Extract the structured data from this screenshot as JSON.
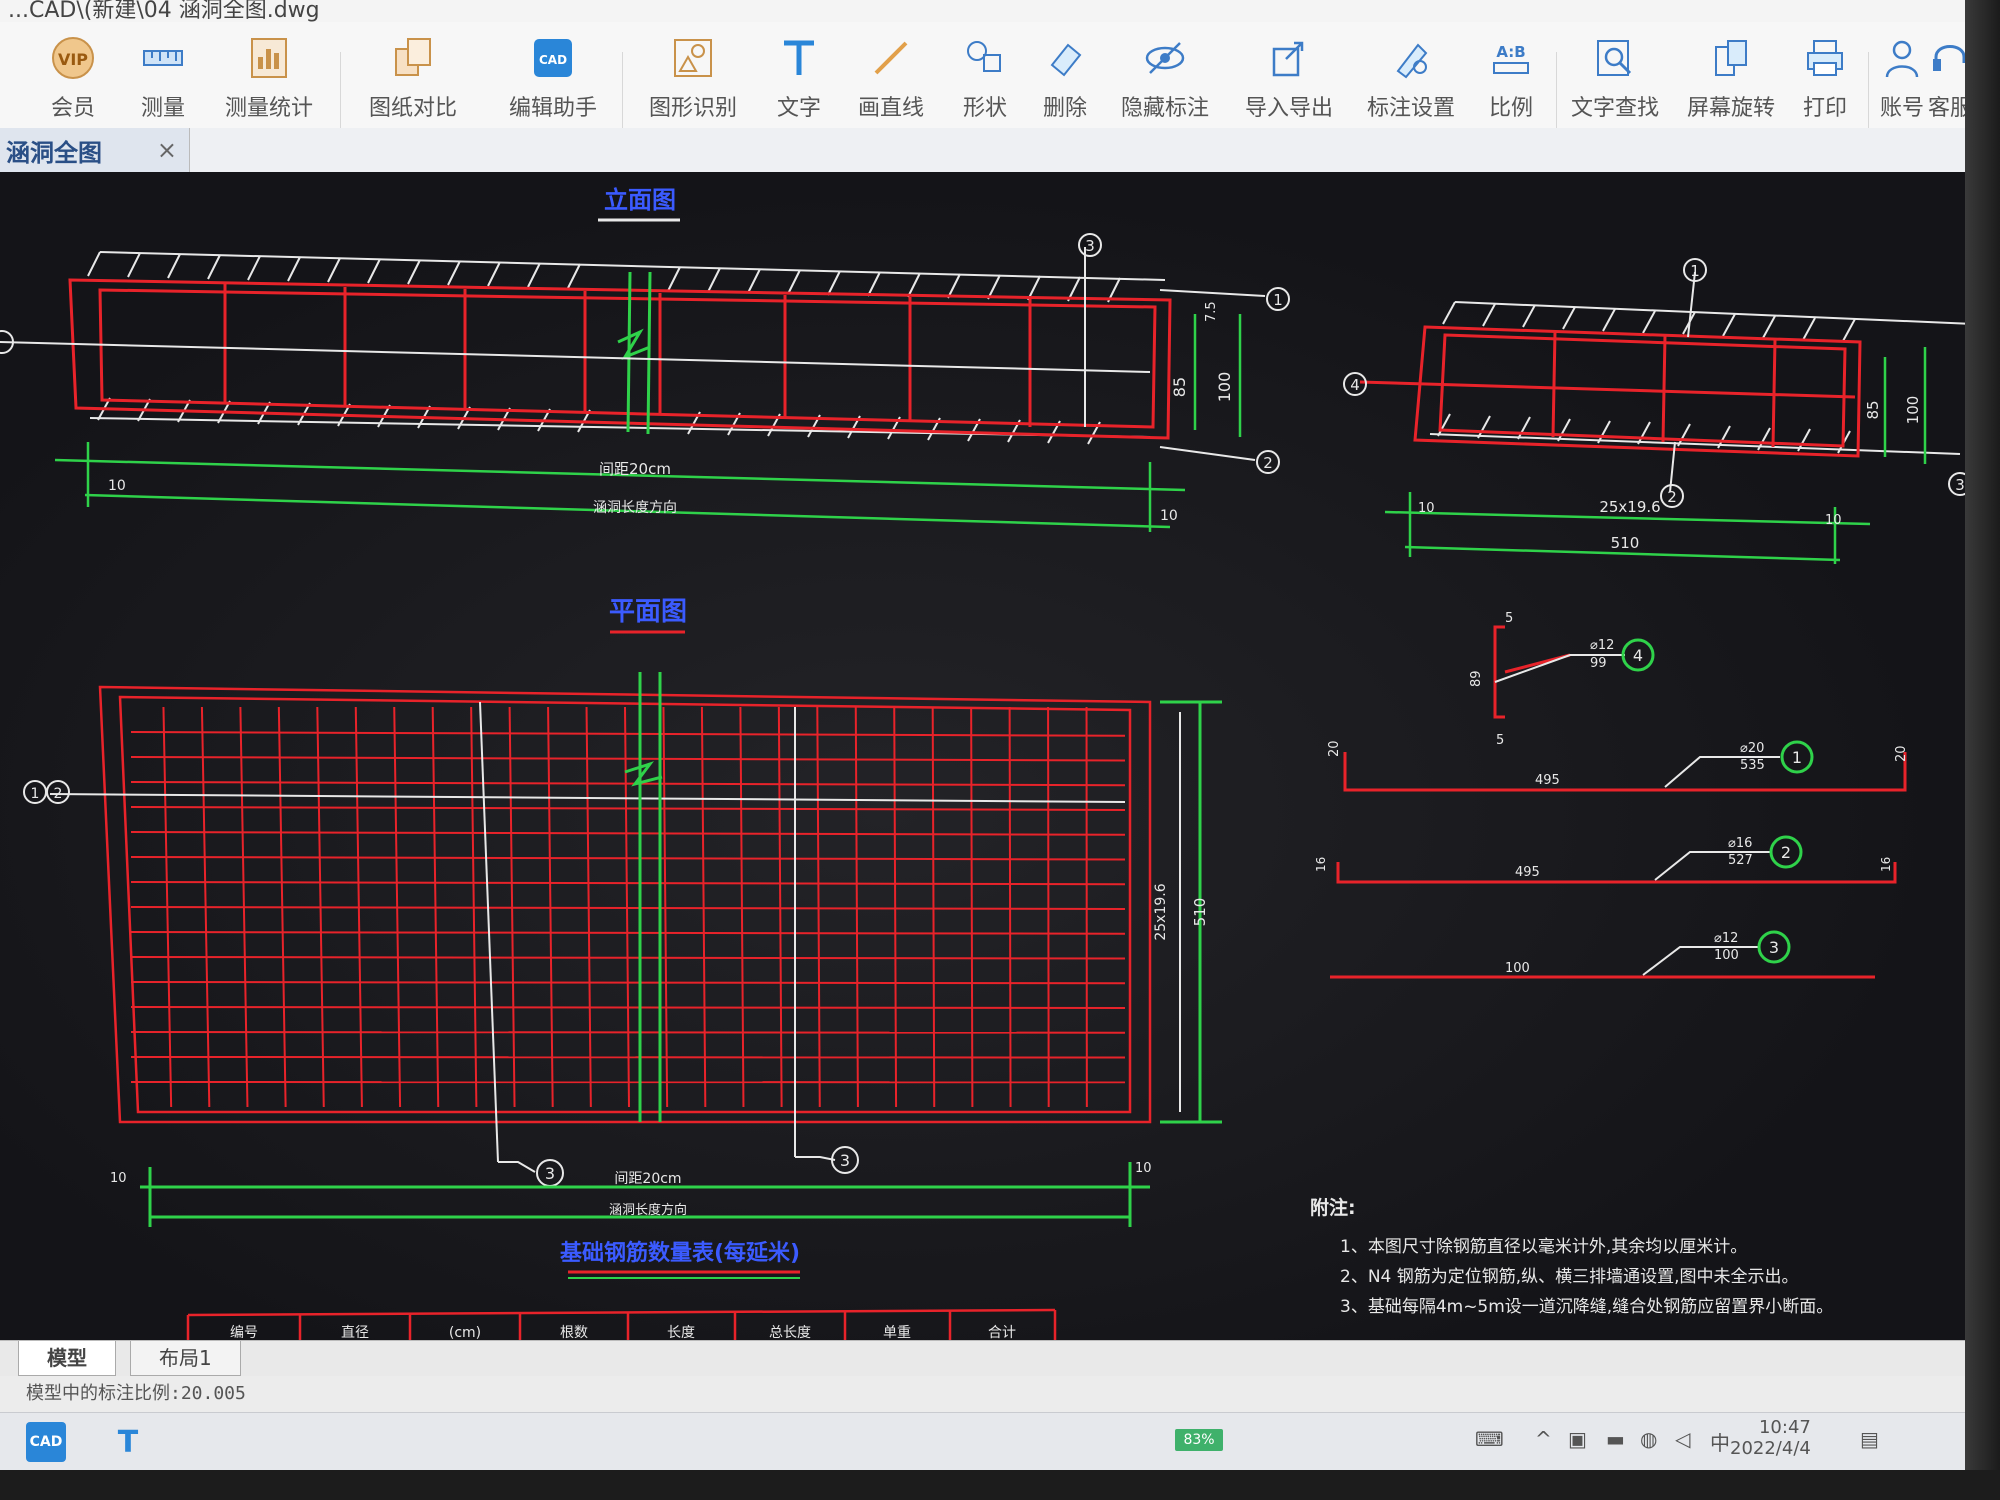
{
  "window": {
    "title": "...CAD\\(新建\\04 涵洞全图.dwg"
  },
  "toolbar": {
    "items": [
      {
        "label": "会员",
        "icon": "vip-icon"
      },
      {
        "label": "测量",
        "icon": "ruler-icon"
      },
      {
        "label": "测量统计",
        "icon": "measure-stats-icon"
      },
      {
        "label": "图纸对比",
        "icon": "compare-icon"
      },
      {
        "label": "编辑助手",
        "icon": "cad-edit-icon"
      },
      {
        "label": "图形识别",
        "icon": "shape-recognize-icon"
      },
      {
        "label": "文字",
        "icon": "text-icon"
      },
      {
        "label": "画直线",
        "icon": "line-icon"
      },
      {
        "label": "形状",
        "icon": "shape-icon"
      },
      {
        "label": "删除",
        "icon": "eraser-icon"
      },
      {
        "label": "隐藏标注",
        "icon": "hide-eye-icon"
      },
      {
        "label": "导入导出",
        "icon": "import-export-icon"
      },
      {
        "label": "标注设置",
        "icon": "annotation-settings-icon"
      },
      {
        "label": "比例",
        "icon": "scale-icon",
        "icon_text": "A:B"
      },
      {
        "label": "文字查找",
        "icon": "text-search-icon"
      },
      {
        "label": "屏幕旋转",
        "icon": "rotate-screen-icon"
      },
      {
        "label": "打印",
        "icon": "printer-icon"
      },
      {
        "label": "账号",
        "icon": "account-icon"
      },
      {
        "label": "客服",
        "icon": "headset-icon"
      }
    ]
  },
  "document_tab": {
    "name": "涵洞全图",
    "close": "×"
  },
  "drawing": {
    "elevation_title": "立面图",
    "plan_title": "平面图",
    "table_title": "基础钢筋数量表(每延米)",
    "dims": {
      "spacing_20": "间距20cm",
      "length_dir": "涵洞长度方向",
      "d10": "10",
      "d85": "85",
      "d100": "100",
      "d75": "7.5",
      "d25x19": "25x19.6",
      "d510": "510",
      "d5": "5",
      "d20": "20",
      "d16": "16",
      "d89": "89",
      "d495": "495",
      "d100b": "100"
    },
    "bubbles": [
      "1",
      "2",
      "3",
      "4"
    ],
    "bar_labels": [
      {
        "top": "⌀12",
        "bottom": "99"
      },
      {
        "top": "⌀20",
        "bottom": "535"
      },
      {
        "top": "⌀16",
        "bottom": "527"
      },
      {
        "top": "⌀12",
        "bottom": "100"
      }
    ],
    "notes_title": "附注:",
    "notes": [
      "1、本图尺寸除钢筋直径以毫米计外,其余均以厘米计。",
      "2、N4 钢筋为定位钢筋,纵、横三排墙通设置,图中未全示出。",
      "3、基础每隔4m~5m设一道沉降缝,缝合处钢筋应留置界小断面。"
    ],
    "table_headers": [
      "编号",
      "直径",
      "(cm)",
      "根数",
      "长度",
      "总长度",
      "单重",
      "合计"
    ]
  },
  "layout_tabs": [
    "模型",
    "布局1"
  ],
  "status": {
    "scale_text": "模型中的标注比例:20.005"
  },
  "taskbar": {
    "battery": "83%",
    "ime": "中",
    "time": "10:47",
    "date": "2022/4/4",
    "apps": [
      "CAD",
      "T"
    ]
  },
  "colors": {
    "rebar": "#e8232a",
    "dimension": "#2fd24a",
    "title_blue": "#3b5bff",
    "leader": "#e8e8e8",
    "ribbon": "#f7f7f7"
  }
}
